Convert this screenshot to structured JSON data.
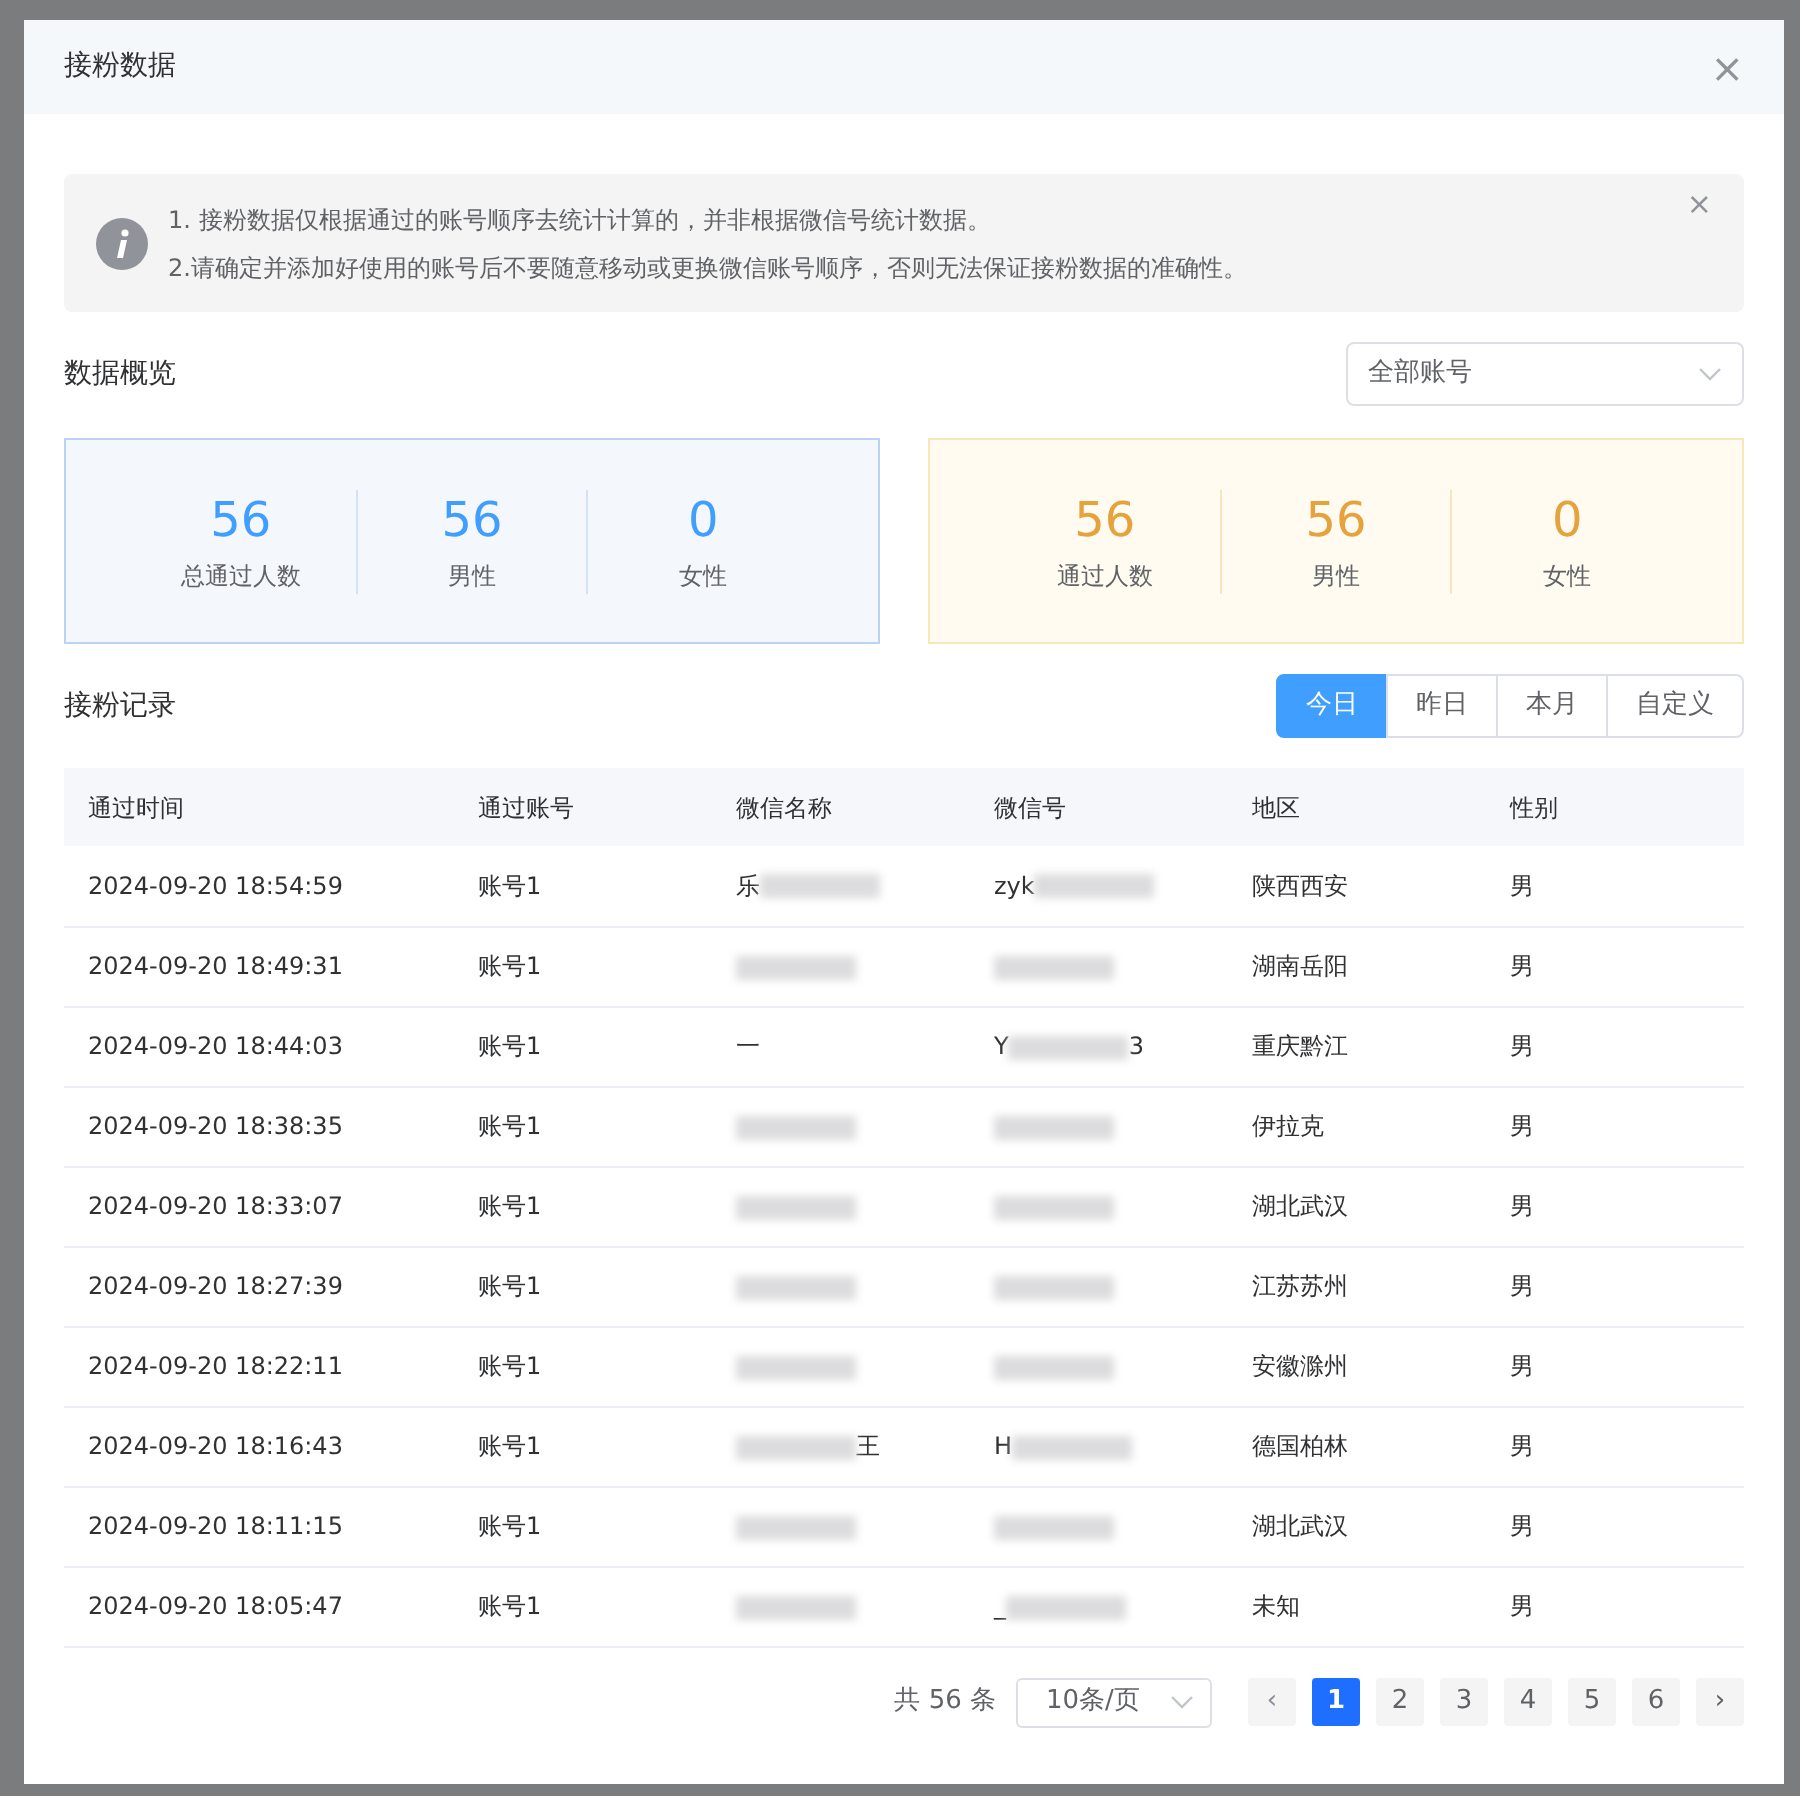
{
  "dialog": {
    "title": "接粉数据",
    "close": "×"
  },
  "notice": {
    "lines": [
      "1. 接粉数据仅根据通过的账号顺序去统计计算的，并非根据微信号统计数据。",
      "2.请确定并添加好使用的账号后不要随意移动或更换微信账号顺序，否则无法保证接粉数据的准确性。"
    ],
    "close": "×"
  },
  "overview": {
    "title": "数据概览",
    "account_select": {
      "value": "全部账号"
    },
    "panels": [
      {
        "kind": "blue",
        "stats": [
          {
            "value": "56",
            "label": "总通过人数"
          },
          {
            "value": "56",
            "label": "男性"
          },
          {
            "value": "0",
            "label": "女性"
          }
        ]
      },
      {
        "kind": "amber",
        "stats": [
          {
            "value": "56",
            "label": "通过人数"
          },
          {
            "value": "56",
            "label": "男性"
          },
          {
            "value": "0",
            "label": "女性"
          }
        ]
      }
    ]
  },
  "records": {
    "title": "接粉记录",
    "ranges": [
      {
        "label": "今日",
        "selected": true
      },
      {
        "label": "昨日",
        "selected": false
      },
      {
        "label": "本月",
        "selected": false
      },
      {
        "label": "自定义",
        "selected": false
      }
    ],
    "columns": [
      "通过时间",
      "通过账号",
      "微信名称",
      "微信号",
      "地区",
      "性别"
    ],
    "rows": [
      [
        {
          "text": "2024-09-20 18:54:59"
        },
        {
          "text": "账号1"
        },
        {
          "text": "乐",
          "redacted": true
        },
        {
          "text": "zyk",
          "redacted": true
        },
        {
          "text": "陕西西安"
        },
        {
          "text": "男"
        }
      ],
      [
        {
          "text": "2024-09-20 18:49:31"
        },
        {
          "text": "账号1"
        },
        {
          "redacted": true
        },
        {
          "redacted": true
        },
        {
          "text": "湖南岳阳"
        },
        {
          "text": "男"
        }
      ],
      [
        {
          "text": "2024-09-20 18:44:03"
        },
        {
          "text": "账号1"
        },
        {
          "text": "一"
        },
        {
          "text": "Y",
          "redacted": true,
          "suffix": "3"
        },
        {
          "text": "重庆黔江"
        },
        {
          "text": "男"
        }
      ],
      [
        {
          "text": "2024-09-20 18:38:35"
        },
        {
          "text": "账号1"
        },
        {
          "redacted": true
        },
        {
          "redacted": true
        },
        {
          "text": "伊拉克"
        },
        {
          "text": "男"
        }
      ],
      [
        {
          "text": "2024-09-20 18:33:07"
        },
        {
          "text": "账号1"
        },
        {
          "redacted": true
        },
        {
          "redacted": true
        },
        {
          "text": "湖北武汉"
        },
        {
          "text": "男"
        }
      ],
      [
        {
          "text": "2024-09-20 18:27:39"
        },
        {
          "text": "账号1"
        },
        {
          "redacted": true
        },
        {
          "redacted": true
        },
        {
          "text": "江苏苏州"
        },
        {
          "text": "男"
        }
      ],
      [
        {
          "text": "2024-09-20 18:22:11"
        },
        {
          "text": "账号1"
        },
        {
          "redacted": true
        },
        {
          "redacted": true
        },
        {
          "text": "安徽滁州"
        },
        {
          "text": "男"
        }
      ],
      [
        {
          "text": "2024-09-20 18:16:43"
        },
        {
          "text": "账号1"
        },
        {
          "redacted": true,
          "suffix": "王"
        },
        {
          "text": "H",
          "redacted": true
        },
        {
          "text": "德国柏林"
        },
        {
          "text": "男"
        }
      ],
      [
        {
          "text": "2024-09-20 18:11:15"
        },
        {
          "text": "账号1"
        },
        {
          "redacted": true
        },
        {
          "redacted": true
        },
        {
          "text": "湖北武汉"
        },
        {
          "text": "男"
        }
      ],
      [
        {
          "text": "2024-09-20 18:05:47"
        },
        {
          "text": "账号1"
        },
        {
          "redacted": true
        },
        {
          "text": "_",
          "redacted": true
        },
        {
          "text": "未知"
        },
        {
          "text": "男"
        }
      ]
    ],
    "pagination": {
      "total": "共 56 条",
      "page_size": "10条/页",
      "prev": "‹",
      "next": "›",
      "pages": [
        {
          "label": "1",
          "selected": true
        },
        {
          "label": "2",
          "selected": false
        },
        {
          "label": "3",
          "selected": false
        },
        {
          "label": "4",
          "selected": false
        },
        {
          "label": "5",
          "selected": false
        },
        {
          "label": "6",
          "selected": false
        }
      ]
    }
  }
}
